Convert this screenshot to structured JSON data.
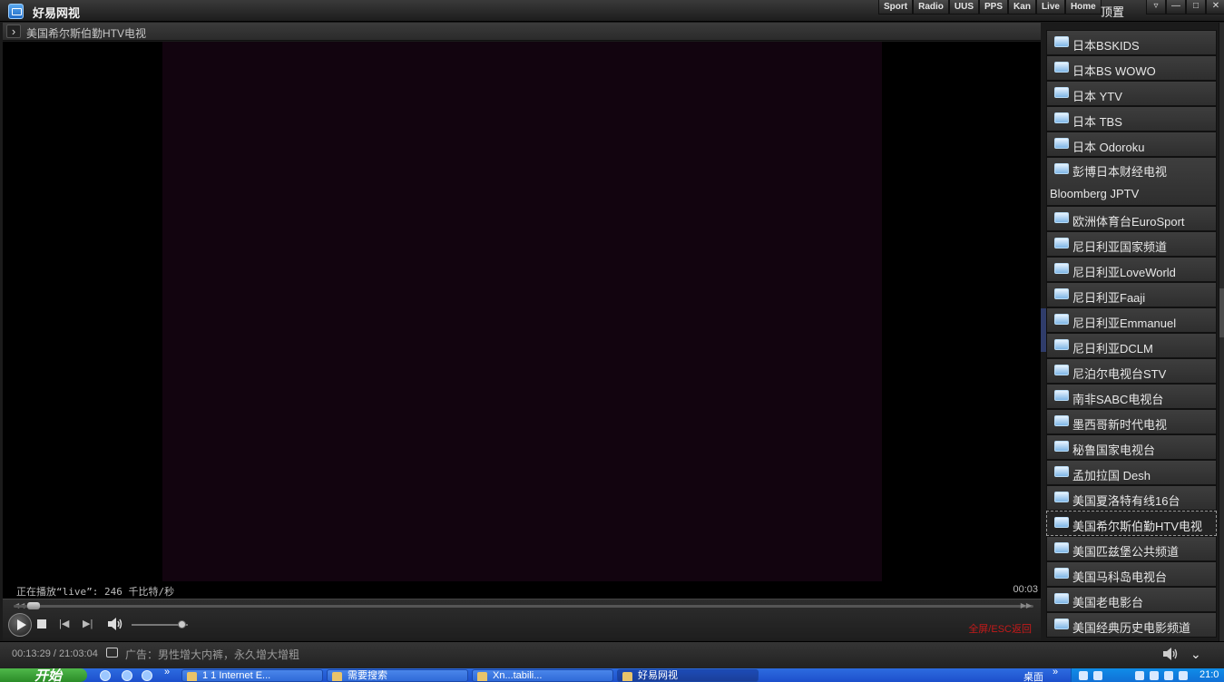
{
  "app": {
    "title": "好易网视",
    "pin_label": "顶置"
  },
  "top_nav": [
    "Sport",
    "Radio",
    "UUS",
    "PPS",
    "Kan",
    "Live",
    "Home"
  ],
  "window_controls": [
    "▿",
    "—",
    "□",
    "✕"
  ],
  "now_playing": {
    "title": "美国希尔斯伯勤HTV电视"
  },
  "player": {
    "status": "正在播放“live”: 246 千比特/秒",
    "elapsed": "00:03",
    "progress_fraction": 0.02,
    "volume_fraction": 0.9,
    "fullscreen_tip": "全屏/ESC返回",
    "prev_label": "|◀",
    "next_label": "▶|"
  },
  "footer": {
    "time_readout": "00:13:29 / 21:03:04",
    "ad_text": "广告：男性增大内裤，永久增大增粗"
  },
  "channels": [
    {
      "label": "日本BSKIDS",
      "icon": "tv-icon"
    },
    {
      "label": "日本BS WOWO",
      "icon": "tv-icon"
    },
    {
      "label": "日本 YTV",
      "icon": "tv-icon"
    },
    {
      "label": "日本 TBS",
      "icon": "tv-icon"
    },
    {
      "label": "日本 Odoroku",
      "icon": "tv-icon"
    },
    {
      "label": "彭博日本财经电视",
      "label2": "Bloomberg JPTV",
      "icon": "tv-icon"
    },
    {
      "label": "欧洲体育台EuroSport",
      "icon": "tv-icon"
    },
    {
      "label": "尼日利亚国家频道",
      "icon": "tv-icon"
    },
    {
      "label": "尼日利亚LoveWorld",
      "icon": "tv-icon"
    },
    {
      "label": "尼日利亚Faaji",
      "icon": "tv-icon"
    },
    {
      "label": "尼日利亚Emmanuel",
      "icon": "tv-icon"
    },
    {
      "label": "尼日利亚DCLM",
      "icon": "tv-icon"
    },
    {
      "label": "尼泊尔电视台STV",
      "icon": "tv-icon"
    },
    {
      "label": "南非SABC电视台",
      "icon": "tv-icon"
    },
    {
      "label": "墨西哥新时代电视",
      "icon": "tv-icon"
    },
    {
      "label": "秘鲁国家电视台",
      "icon": "tv-icon"
    },
    {
      "label": "孟加拉国 Desh",
      "icon": "tv-icon"
    },
    {
      "label": "美国夏洛特有线16台",
      "icon": "tv-icon"
    },
    {
      "label": "美国希尔斯伯勤HTV电视",
      "icon": "tv-icon",
      "active": true
    },
    {
      "label": "美国匹兹堡公共频道",
      "icon": "tv-icon"
    },
    {
      "label": "美国马科岛电视台",
      "icon": "tv-icon"
    },
    {
      "label": "美国老电影台",
      "icon": "tv-icon"
    },
    {
      "label": "美国经典历史电影频道",
      "icon": "tv-icon"
    }
  ],
  "taskbar": {
    "start_label": "开始",
    "tasks": [
      {
        "label": "1 1 Internet E..."
      },
      {
        "label": "需要搜索"
      },
      {
        "label": "Xn...tabili..."
      },
      {
        "label": "好易网视",
        "active": true
      }
    ],
    "desktop_label": "桌面",
    "clock": "21:0"
  }
}
